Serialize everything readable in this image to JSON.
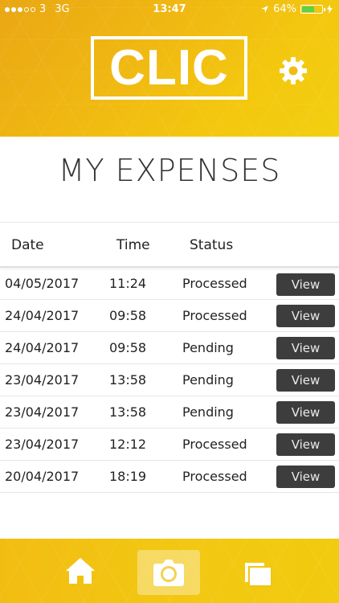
{
  "status_bar": {
    "carrier": "3",
    "network": "3G",
    "time": "13:47",
    "battery": "64%",
    "battery_level": 0.64
  },
  "header": {
    "logo": "CLIC",
    "settings_icon": "gear-icon"
  },
  "page_title": "MY EXPENSES",
  "table": {
    "columns": [
      "Date",
      "Time",
      "Status"
    ],
    "rows": [
      {
        "date": "04/05/2017",
        "time": "11:24",
        "status": "Processed",
        "action": "View"
      },
      {
        "date": "24/04/2017",
        "time": "09:58",
        "status": "Processed",
        "action": "View"
      },
      {
        "date": "24/04/2017",
        "time": "09:58",
        "status": "Pending",
        "action": "View"
      },
      {
        "date": "23/04/2017",
        "time": "13:58",
        "status": "Pending",
        "action": "View"
      },
      {
        "date": "23/04/2017",
        "time": "13:58",
        "status": "Pending",
        "action": "View"
      },
      {
        "date": "23/04/2017",
        "time": "12:12",
        "status": "Processed",
        "action": "View"
      },
      {
        "date": "20/04/2017",
        "time": "18:19",
        "status": "Processed",
        "action": "View"
      }
    ]
  },
  "bottom_nav": {
    "items": [
      "home-icon",
      "camera-icon",
      "documents-icon"
    ],
    "active": "camera-icon"
  },
  "colors": {
    "accent_yellow": "#f2c212",
    "button_dark": "#3d3d3d",
    "battery_green": "#5bd24a"
  }
}
